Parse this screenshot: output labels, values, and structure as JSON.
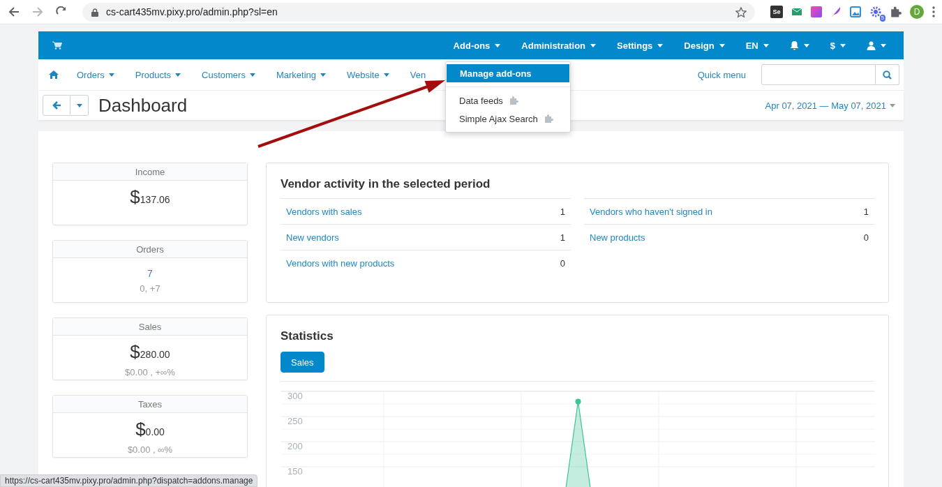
{
  "browser": {
    "url": "cs-cart435mv.pixy.pro/admin.php?sl=en",
    "extensions": [
      {
        "kind": "label",
        "label": "Se"
      },
      {
        "kind": "mail"
      },
      {
        "kind": "gradient"
      },
      {
        "kind": "feather"
      },
      {
        "kind": "image"
      },
      {
        "kind": "gear",
        "badge": "5"
      },
      {
        "kind": "puzzle"
      }
    ],
    "profile_initial": "D"
  },
  "top_menu": [
    {
      "kind": "text",
      "label": "Add-ons"
    },
    {
      "kind": "text",
      "label": "Administration"
    },
    {
      "kind": "text",
      "label": "Settings"
    },
    {
      "kind": "text",
      "label": "Design"
    },
    {
      "kind": "text",
      "label": "EN"
    },
    {
      "kind": "bell"
    },
    {
      "kind": "text",
      "label": "$"
    },
    {
      "kind": "user"
    }
  ],
  "addons_dropdown": [
    {
      "kind": "action",
      "label": "Manage add-ons",
      "selected": true
    },
    {
      "kind": "addon",
      "label": "Data feeds",
      "selected": false
    },
    {
      "kind": "addon",
      "label": "Simple Ajax Search",
      "selected": false
    }
  ],
  "nav": {
    "items": [
      {
        "label": "Orders",
        "caret": true
      },
      {
        "label": "Products",
        "caret": true
      },
      {
        "label": "Customers",
        "caret": true
      },
      {
        "label": "Marketing",
        "caret": true
      },
      {
        "label": "Website",
        "caret": true
      },
      {
        "label": "Ven",
        "caret": false
      }
    ],
    "quick_menu": "Quick menu"
  },
  "page": {
    "title": "Dashboard",
    "date_range": "Apr 07, 2021 — May 07, 2021"
  },
  "stats": [
    {
      "kind": "money",
      "title": "Income",
      "currency": "$",
      "value": "137.06"
    },
    {
      "kind": "count",
      "title": "Orders",
      "value": "7",
      "change": "0, +7"
    },
    {
      "kind": "money",
      "title": "Sales",
      "currency": "$",
      "value": "280.00",
      "change": "$0.00 , +∞%"
    },
    {
      "kind": "money",
      "title": "Taxes",
      "currency": "$",
      "value": "0.00",
      "change": "$0.00 , ∞%"
    }
  ],
  "vendor_activity": {
    "title": "Vendor activity in the selected period",
    "columns": [
      [
        {
          "label": "Vendors with sales",
          "value": "1"
        },
        {
          "label": "New vendors",
          "value": "1"
        },
        {
          "label": "Vendors with new products",
          "value": "0"
        }
      ],
      [
        {
          "label": "Vendors who haven't signed in",
          "value": "1"
        },
        {
          "label": "New products",
          "value": "0"
        }
      ]
    ]
  },
  "statistics": {
    "title": "Statistics",
    "tabs": [
      {
        "label": "Sales",
        "selected": true
      }
    ],
    "chart_data": {
      "type": "area",
      "grid": true,
      "ylim": [
        0,
        300
      ],
      "yticks": [
        150,
        200,
        250,
        300
      ],
      "series": [
        {
          "color": "#3cc497",
          "values": [
            null,
            null,
            null,
            null,
            null,
            null,
            null,
            null,
            null,
            null,
            null,
            null,
            null,
            null,
            0,
            280,
            0,
            null,
            null,
            null,
            null,
            null,
            null,
            null,
            null,
            null,
            null,
            null,
            null,
            null,
            null
          ]
        }
      ]
    }
  },
  "status_bar": "https://cs-cart435mv.pixy.pro/admin.php?dispatch=addons.manage"
}
